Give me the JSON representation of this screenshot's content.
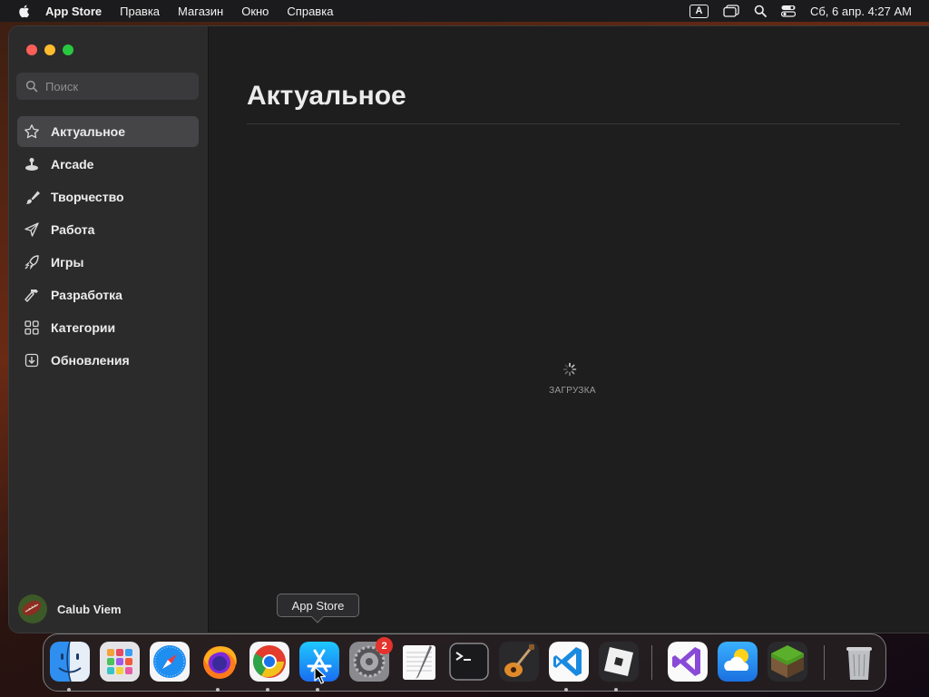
{
  "menubar": {
    "app_name": "App Store",
    "items": [
      "Правка",
      "Магазин",
      "Окно",
      "Справка"
    ],
    "input_source": "A",
    "clock": "Сб, 6 апр.  4:27 AM"
  },
  "sidebar": {
    "search_placeholder": "Поиск",
    "items": [
      {
        "label": "Актуальное",
        "icon": "star-icon",
        "selected": true
      },
      {
        "label": "Arcade",
        "icon": "joystick-icon",
        "selected": false
      },
      {
        "label": "Творчество",
        "icon": "paintbrush-icon",
        "selected": false
      },
      {
        "label": "Работа",
        "icon": "paperplane-icon",
        "selected": false
      },
      {
        "label": "Игры",
        "icon": "rocket-icon",
        "selected": false
      },
      {
        "label": "Разработка",
        "icon": "hammer-icon",
        "selected": false
      },
      {
        "label": "Категории",
        "icon": "grid-icon",
        "selected": false
      },
      {
        "label": "Обновления",
        "icon": "download-icon",
        "selected": false
      }
    ],
    "user_name": "Calub Viem"
  },
  "main": {
    "title": "Актуальное",
    "loading_text": "ЗАГРУЗКА"
  },
  "tooltip": {
    "text": "App Store"
  },
  "dock": {
    "apps": [
      {
        "name": "Finder",
        "icon": "finder-icon",
        "running": true
      },
      {
        "name": "Launchpad",
        "icon": "launchpad-icon",
        "running": false
      },
      {
        "name": "Safari",
        "icon": "safari-icon",
        "running": false
      },
      {
        "name": "Firefox",
        "icon": "firefox-icon",
        "running": true
      },
      {
        "name": "Chrome",
        "icon": "chrome-icon",
        "running": true
      },
      {
        "name": "App Store",
        "icon": "app-store-icon",
        "running": true
      },
      {
        "name": "System Settings",
        "icon": "settings-icon",
        "running": false,
        "badge": "2"
      },
      {
        "name": "TextEdit",
        "icon": "textedit-icon",
        "running": false
      },
      {
        "name": "Terminal",
        "icon": "terminal-icon",
        "running": false
      },
      {
        "name": "GarageBand",
        "icon": "garageband-icon",
        "running": false
      },
      {
        "name": "Visual Studio Code",
        "icon": "vscode-icon",
        "running": true
      },
      {
        "name": "Roblox",
        "icon": "roblox-icon",
        "running": true
      },
      {
        "name": "Visual Studio",
        "icon": "visual-studio-icon",
        "running": false
      },
      {
        "name": "Weather",
        "icon": "weather-icon",
        "running": false
      },
      {
        "name": "Minecraft",
        "icon": "minecraft-icon",
        "running": false
      },
      {
        "name": "Trash",
        "icon": "trash-icon",
        "running": false
      }
    ],
    "settings_badge": "2"
  },
  "colors": {
    "window_bg": "#1e1e1e",
    "sidebar_bg": "#2b2b2c",
    "selected_bg": "#454547",
    "badge_red": "#e5322d"
  }
}
